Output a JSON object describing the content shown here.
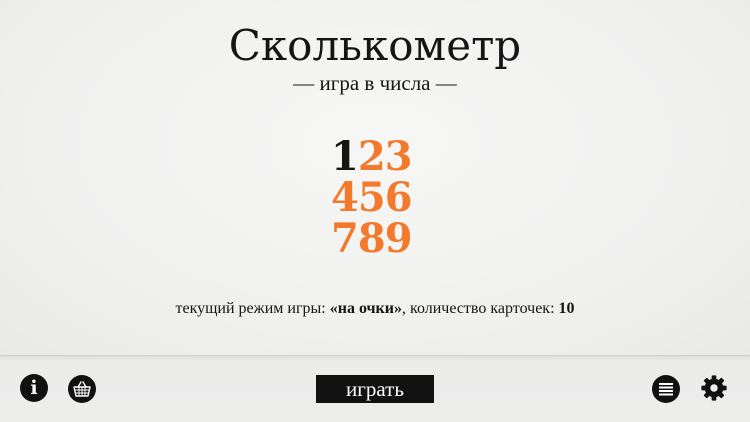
{
  "header": {
    "title": "Сколькометр",
    "subtitle": "— игра в числа —"
  },
  "logo": {
    "rows": [
      "123",
      "456",
      "789"
    ],
    "digits": [
      "1",
      "2",
      "3",
      "4",
      "5",
      "6",
      "7",
      "8",
      "9"
    ],
    "highlight_color": "#151515",
    "accent_color": "#f37a2d"
  },
  "status": {
    "mode_prefix": "текущий режим игры: ",
    "mode_value": "«на очки»",
    "count_prefix": ", количество карточек: ",
    "count_value": "10"
  },
  "toolbar": {
    "info_label": "i",
    "info_icon": "info-icon",
    "shop_icon": "basket-icon",
    "play_label": "играть",
    "list_icon": "list-icon",
    "settings_icon": "gear-icon"
  }
}
